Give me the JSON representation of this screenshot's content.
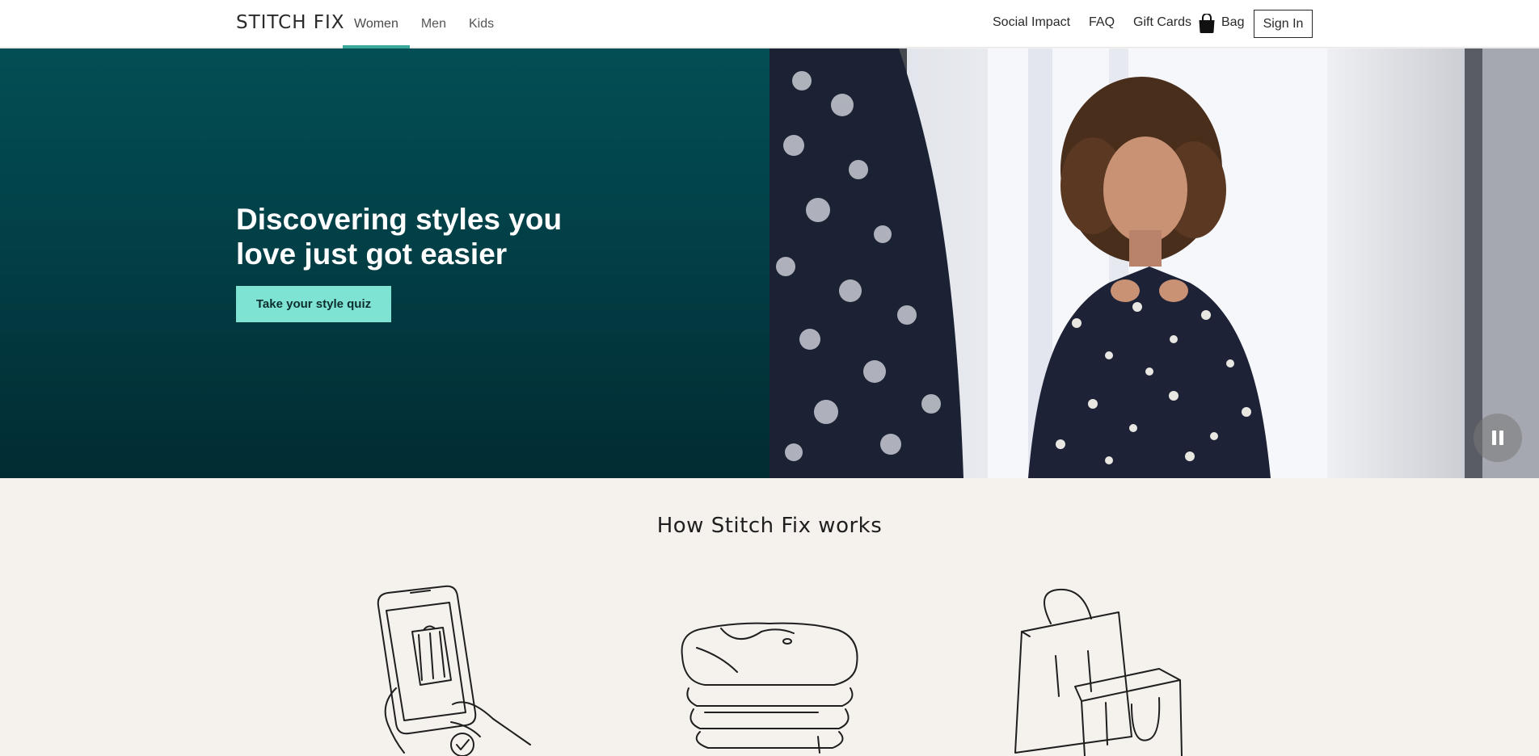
{
  "header": {
    "logo": "STITCH FIX",
    "nav_left": [
      "Women",
      "Men",
      "Kids"
    ],
    "active_nav": "Women",
    "nav_right": {
      "social_impact": "Social Impact",
      "faq": "FAQ",
      "gift_cards": "Gift Cards",
      "bag": "Bag",
      "sign_in": "Sign In"
    }
  },
  "hero": {
    "title": "Discovering styles you love just got easier",
    "cta": "Take your style quiz"
  },
  "how_it_works": {
    "title": "How Stitch Fix works"
  },
  "colors": {
    "accent": "#3aa89a",
    "hero_bg": "#02434a",
    "cta_bg": "#7fe3d4",
    "section_bg": "#f5f1ec"
  }
}
